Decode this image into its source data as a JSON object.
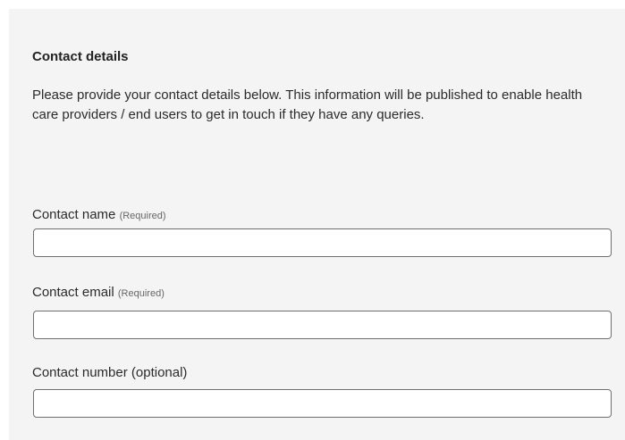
{
  "section": {
    "title": "Contact details",
    "intro": "Please provide your contact details below. This information will be published to enable health care providers / end users to get in touch if they have any queries."
  },
  "fields": {
    "contact_name": {
      "label": "Contact name",
      "required_tag": "(Required)",
      "value": ""
    },
    "contact_email": {
      "label": "Contact email",
      "required_tag": "(Required)",
      "value": ""
    },
    "contact_number": {
      "label": "Contact number (optional)",
      "value": ""
    }
  },
  "colors": {
    "panel_background": "#f4f4f4",
    "input_border": "#6f6f6f",
    "text": "#222222"
  }
}
